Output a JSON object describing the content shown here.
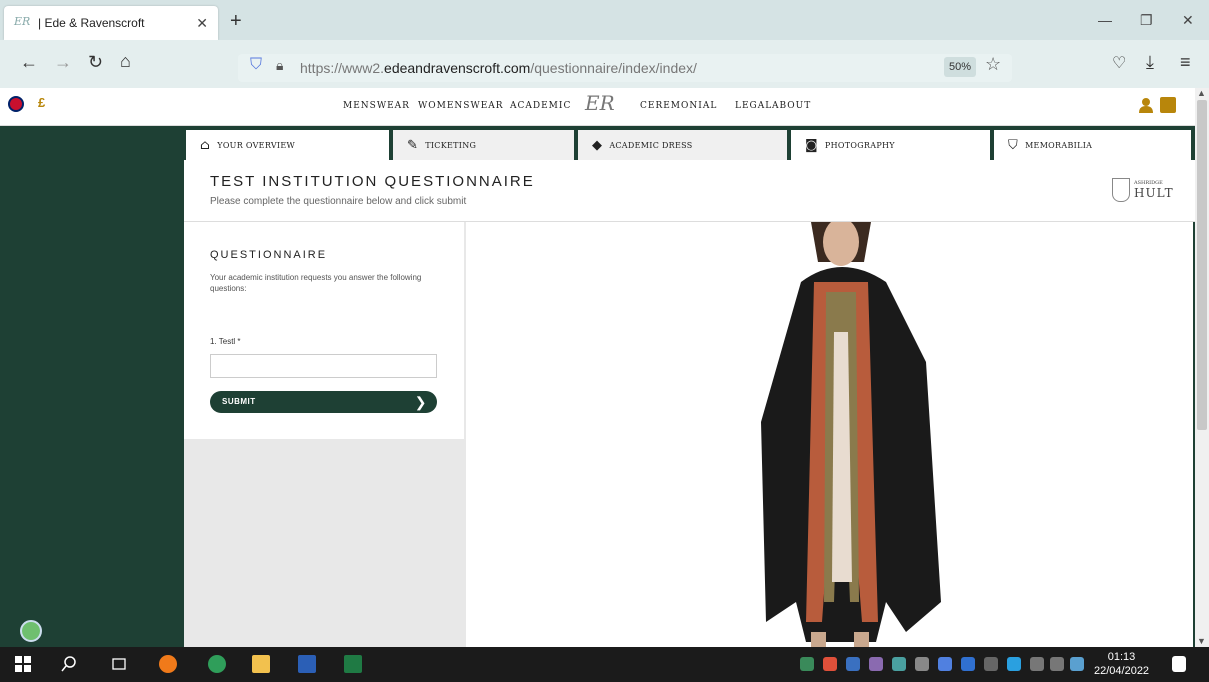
{
  "browser": {
    "tab_title": "| Ede & Ravenscroft",
    "tab_icon_text": "ER",
    "url_prefix": "https://www2.",
    "url_domain": "edeandravenscroft.com",
    "url_path": "/questionnaire/index/index/",
    "zoom": "50%"
  },
  "site": {
    "currency": "£",
    "logo_text": "ER",
    "nav": [
      "MENSWEAR",
      "WOMENSWEAR",
      "ACADEMIC",
      "CEREMONIAL",
      "LEGAL",
      "ABOUT"
    ]
  },
  "section_tabs": [
    "YOUR OVERVIEW",
    "TICKETING",
    "ACADEMIC DRESS",
    "PHOTOGRAPHY",
    "MEMORABILIA"
  ],
  "page": {
    "title": "TEST INSTITUTION QUESTIONNAIRE",
    "subtitle": "Please complete the questionnaire below and click submit",
    "institution_small": "ASHRIDGE",
    "institution_big": "HULT"
  },
  "questionnaire": {
    "heading": "QUESTIONNAIRE",
    "description": "Your academic institution requests you answer the following questions:",
    "question_label": "1. Testl *",
    "answer_value": "",
    "submit_label": "SUBMIT"
  },
  "taskbar": {
    "time": "01:13",
    "date": "22/04/2022"
  }
}
